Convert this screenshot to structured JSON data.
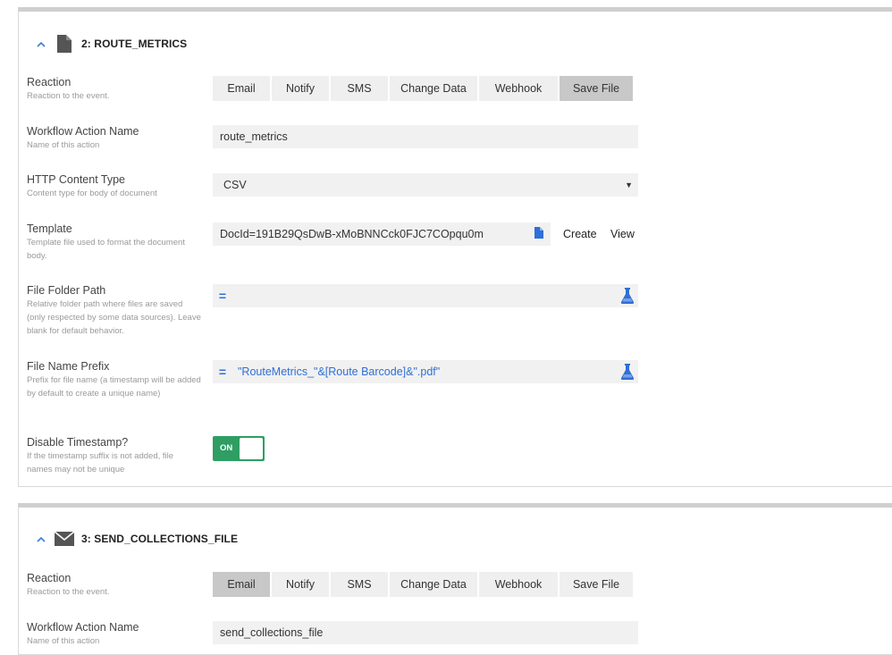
{
  "cards": [
    {
      "title": "2: ROUTE_METRICS",
      "reaction": {
        "label": "Reaction",
        "desc": "Reaction to the event.",
        "options": [
          "Email",
          "Notify",
          "SMS",
          "Change Data",
          "Webhook",
          "Save File"
        ],
        "selected": "Save File"
      },
      "action_name": {
        "label": "Workflow Action Name",
        "desc": "Name of this action",
        "value": "route_metrics"
      },
      "content_type": {
        "label": "HTTP Content Type",
        "desc": "Content type for body of document",
        "value": "CSV"
      },
      "template": {
        "label": "Template",
        "desc": "Template file used to format the document body.",
        "value": "DocId=191B29QsDwB-xMoBNNCck0FJC7COpqu0m",
        "create_label": "Create",
        "view_label": "View"
      },
      "folder_path": {
        "label": "File Folder Path",
        "desc": "Relative folder path where files are saved (only respected by some data sources). Leave blank for default behavior.",
        "value": ""
      },
      "name_prefix": {
        "label": "File Name Prefix",
        "desc": "Prefix for file name (a timestamp will be added by default to create a unique name)",
        "value": "\"RouteMetrics_\"&[Route Barcode]&\".pdf\""
      },
      "disable_timestamp": {
        "label": "Disable Timestamp?",
        "desc": "If the timestamp suffix is not added, file names may not be unique",
        "toggle_text": "ON"
      }
    },
    {
      "title": "3: SEND_COLLECTIONS_FILE",
      "reaction": {
        "label": "Reaction",
        "desc": "Reaction to the event.",
        "options": [
          "Email",
          "Notify",
          "SMS",
          "Change Data",
          "Webhook",
          "Save File"
        ],
        "selected": "Email"
      },
      "action_name": {
        "label": "Workflow Action Name",
        "desc": "Name of this action",
        "value": "send_collections_file"
      }
    }
  ],
  "icons": {
    "collapse": "chevron-up-icon",
    "card1": "document-icon",
    "card2": "envelope-icon",
    "template_file": "document-icon",
    "formula": "equals-icon",
    "test": "flask-icon"
  },
  "colors": {
    "accent_blue": "#2f6fd6",
    "toggle_green": "#2e9e63",
    "segment_active": "#c8c8c8"
  }
}
